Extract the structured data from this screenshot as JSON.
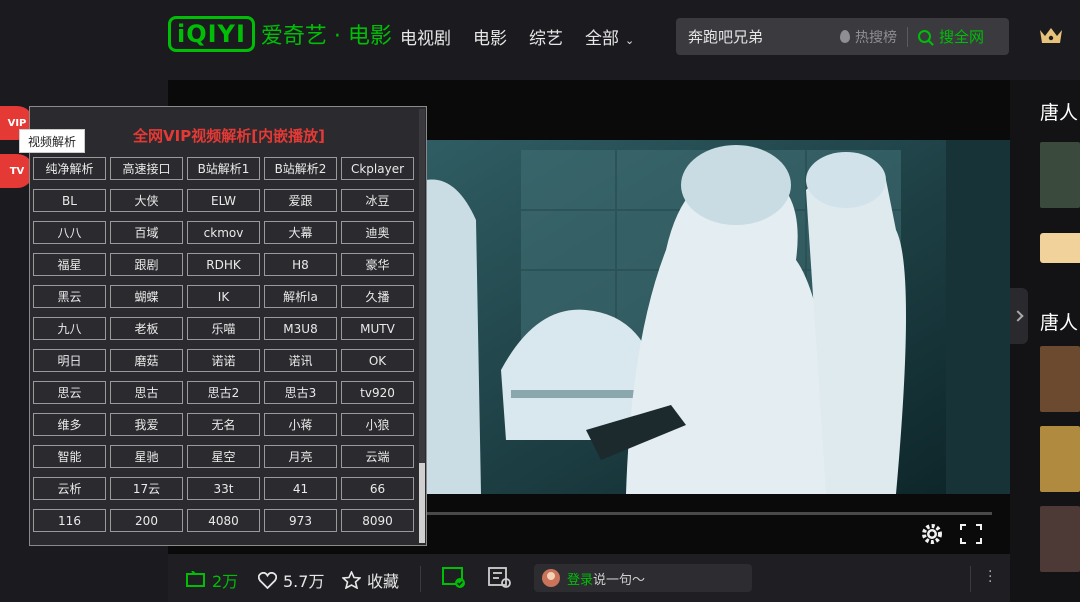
{
  "header": {
    "logo_mark": "iQIYI",
    "logo_text": "爱奇艺 · 电影",
    "nav": [
      {
        "label": "电视剧"
      },
      {
        "label": "电影"
      },
      {
        "label": "综艺"
      },
      {
        "label": "全部"
      }
    ],
    "search": {
      "value": "奔跑吧兄弟",
      "hot_label": "热搜榜",
      "button_label": "搜全网"
    }
  },
  "side": {
    "titles": [
      "唐人",
      "唐人"
    ]
  },
  "floating": {
    "vip_icon_label": "VIP",
    "tv_icon_label": "TV",
    "tooltip": "视频解析"
  },
  "vip_panel": {
    "title": "全网VIP视频解析[内嵌播放]",
    "buttons": [
      "纯净解析",
      "高速接口",
      "B站解析1",
      "B站解析2",
      "Ckplayer",
      "BL",
      "大侠",
      "ELW",
      "爱跟",
      "冰豆",
      "八八",
      "百域",
      "ckmov",
      "大幕",
      "迪奥",
      "福星",
      "跟剧",
      "RDHK",
      "H8",
      "豪华",
      "黑云",
      "蝴蝶",
      "IK",
      "解析la",
      "久播",
      "九八",
      "老板",
      "乐喵",
      "M3U8",
      "MUTV",
      "明日",
      "磨菇",
      "诺诺",
      "诺讯",
      "OK",
      "思云",
      "思古",
      "思古2",
      "思古3",
      "tv920",
      "维多",
      "我爱",
      "无名",
      "小蒋",
      "小狼",
      "智能",
      "星驰",
      "星空",
      "月亮",
      "云端",
      "云析",
      "17云",
      "33t",
      "41",
      "66",
      "116",
      "200",
      "4080",
      "973",
      "8090"
    ]
  },
  "bottom": {
    "danmaku_count": "2万",
    "likes": "5.7万",
    "collect_label": "收藏",
    "comment_login": "登录",
    "comment_prompt": "说一句～"
  },
  "colors": {
    "brand_green": "#00be06",
    "accent_red": "#e53935",
    "bg": "#1b1b1f"
  }
}
